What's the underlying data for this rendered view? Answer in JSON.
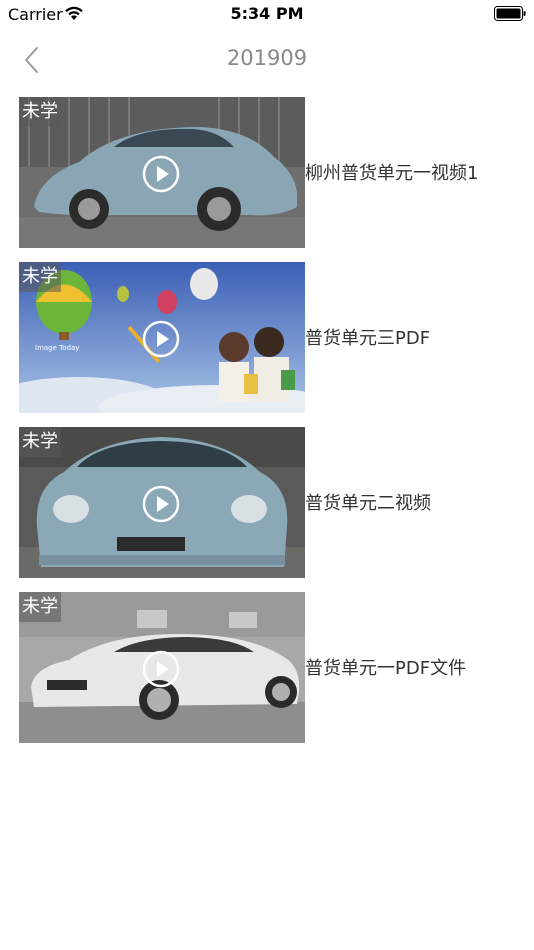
{
  "status_bar": {
    "carrier": "Carrier",
    "time": "5:34 PM"
  },
  "nav": {
    "title": "201909"
  },
  "items": [
    {
      "badge": "未学",
      "title": "柳州普货单元一视频1",
      "thumbnail": "blue-beetle-side"
    },
    {
      "badge": "未学",
      "title": "普货单元三PDF",
      "thumbnail": "children-balloons"
    },
    {
      "badge": "未学",
      "title": "普货单元二视频",
      "thumbnail": "blue-beetle-front"
    },
    {
      "badge": "未学",
      "title": "普货单元一PDF文件",
      "thumbnail": "white-sedan"
    }
  ],
  "colors": {
    "badge_bg": "#5a5a5a",
    "title_gray": "#888888",
    "text": "#333333"
  }
}
